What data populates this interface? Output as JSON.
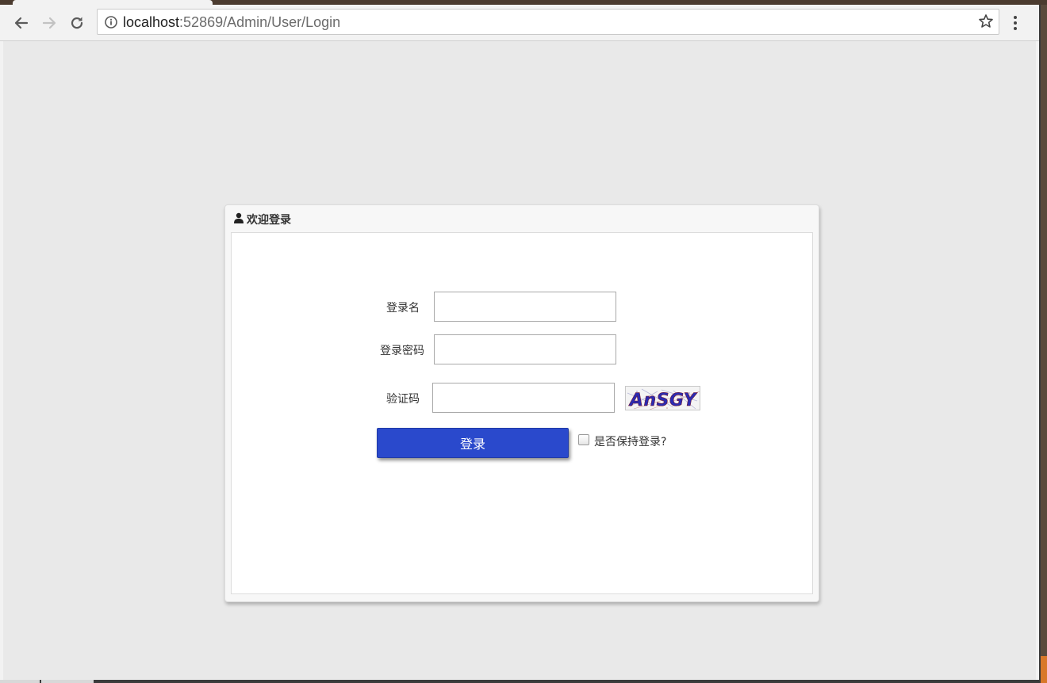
{
  "browser": {
    "url_host": "localhost",
    "url_rest": ":52869/Admin/User/Login",
    "icons": {
      "back": "arrow-left",
      "forward": "arrow-right",
      "reload": "reload",
      "info": "info-circle",
      "bookmark": "star",
      "menu": "vertical-dots"
    }
  },
  "panel": {
    "title": "欢迎登录",
    "title_icon": "user"
  },
  "form": {
    "username_label": "登录名",
    "username_value": "",
    "password_label": "登录密码",
    "password_value": "",
    "captcha_label": "验证码",
    "captcha_value": "",
    "captcha_text": "AnSGY",
    "login_button": "登录",
    "remember_label": "是否保持登录?",
    "remember_checked": false
  },
  "colors": {
    "login_button": "#2a49cc",
    "page_background": "#e9e9e9"
  }
}
